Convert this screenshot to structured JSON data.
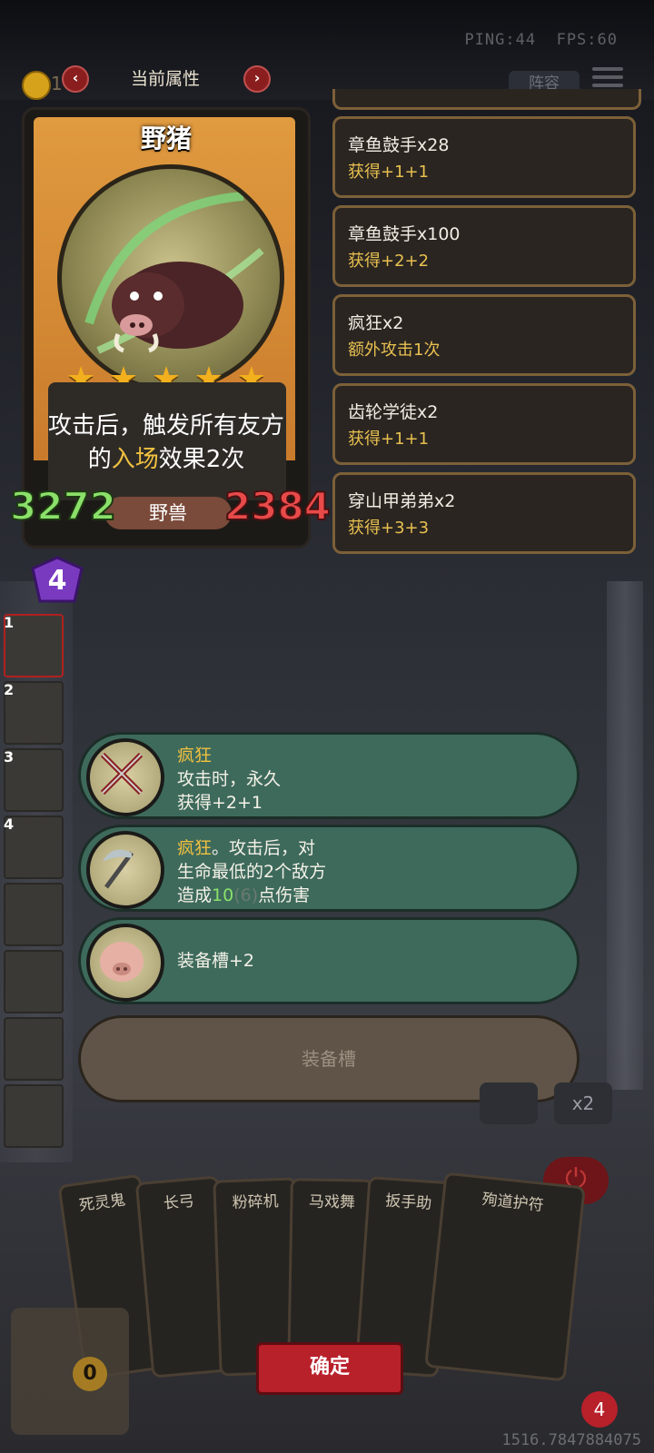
{
  "hud": {
    "ping": "PING:44",
    "fps": "FPS:60",
    "title": "当前属性",
    "coins": "1",
    "lineup": "阵容"
  },
  "card": {
    "name": "野猪",
    "stars": 5,
    "desc_prefix": "攻击后，触发所有友方的",
    "desc_highlight": "入场",
    "desc_suffix": "效果2次",
    "attack": "3272",
    "health": "2384",
    "tribe": "野兽",
    "tier": "4"
  },
  "buffs": [
    {
      "title": "章鱼鼓手x28",
      "detail": "获得+1+1"
    },
    {
      "title": "章鱼鼓手x100",
      "detail": "获得+2+2"
    },
    {
      "title": "疯狂x2",
      "detail": "额外攻击1次"
    },
    {
      "title": "齿轮学徒x2",
      "detail": "获得+1+1"
    },
    {
      "title": "穿山甲弟弟x2",
      "detail": "获得+3+3"
    }
  ],
  "tier_slots": [
    "1",
    "2",
    "3",
    "4",
    "",
    "",
    "",
    ""
  ],
  "skills": [
    {
      "icon": "crossed-swords-icon",
      "name": "疯狂",
      "line1": "攻击时，永久",
      "line2": "获得+2+1"
    },
    {
      "icon": "scythe-icon",
      "name": "疯狂",
      "name_suffix": "。攻击后，对",
      "line2": "生命最低的2个敌方",
      "line3_pre": "造成",
      "line3_num": "10",
      "line3_dim": "(6)",
      "line3_post": "点伤害"
    },
    {
      "icon": "pig-face-icon",
      "label": "装备槽+2"
    }
  ],
  "equip_slot": "装备槽",
  "hand": [
    "死灵鬼",
    "长弓",
    "粉碎机",
    "马戏舞",
    "扳手助",
    "殉道护符"
  ],
  "confirm": "确定",
  "speed": "x2",
  "chest_count": "0",
  "lives": "4",
  "coords_readout": "1516.7847884075"
}
